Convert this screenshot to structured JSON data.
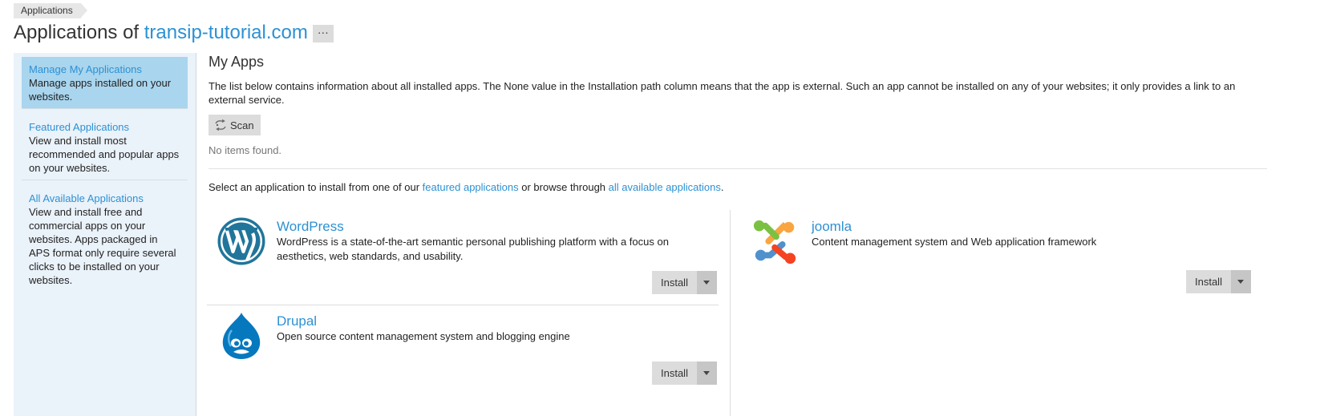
{
  "breadcrumb": {
    "label": "Applications"
  },
  "header": {
    "title_prefix": "Applications of ",
    "domain": "transip-tutorial.com",
    "more_label": "···"
  },
  "sidebar": {
    "items": [
      {
        "label": "Manage My Applications",
        "description": "Manage apps installed on your websites.",
        "active": true
      },
      {
        "label": "Featured Applications",
        "description": "View and install most recommended and popular apps on your websites.",
        "active": false
      },
      {
        "label": "All Available Applications",
        "description": "View and install free and commercial apps on your websites. Apps packaged in APS format only require several clicks to be installed on your websites.",
        "active": false
      }
    ]
  },
  "main": {
    "heading": "My Apps",
    "intro": "The list below contains information about all installed apps. The None value in the Installation path column means that the app is external. Such an app cannot be installed on any of your websites; it only provides a link to an external service.",
    "scan_label": "Scan",
    "empty_text": "No items found.",
    "select_prefix": "Select an application to install from one of our ",
    "featured_link": "featured applications",
    "select_middle": " or browse through ",
    "all_link": "all available applications",
    "select_suffix": "."
  },
  "apps": [
    {
      "name": "WordPress",
      "description": "WordPress is a state-of-the-art semantic personal publishing platform with a focus on aesthetics, web standards, and usability.",
      "install_label": "Install",
      "icon": "wordpress-logo"
    },
    {
      "name": "Drupal",
      "description": "Open source content management system and blogging engine",
      "install_label": "Install",
      "icon": "drupal-logo"
    },
    {
      "name": "joomla",
      "description": "Content management system and Web application framework",
      "install_label": "Install",
      "icon": "joomla-logo"
    }
  ],
  "colors": {
    "link": "#2c91d3",
    "sidebar_bg": "#eaf2fa",
    "sidebar_active": "#a9d5ee",
    "button_bg": "#dcdcdc"
  }
}
